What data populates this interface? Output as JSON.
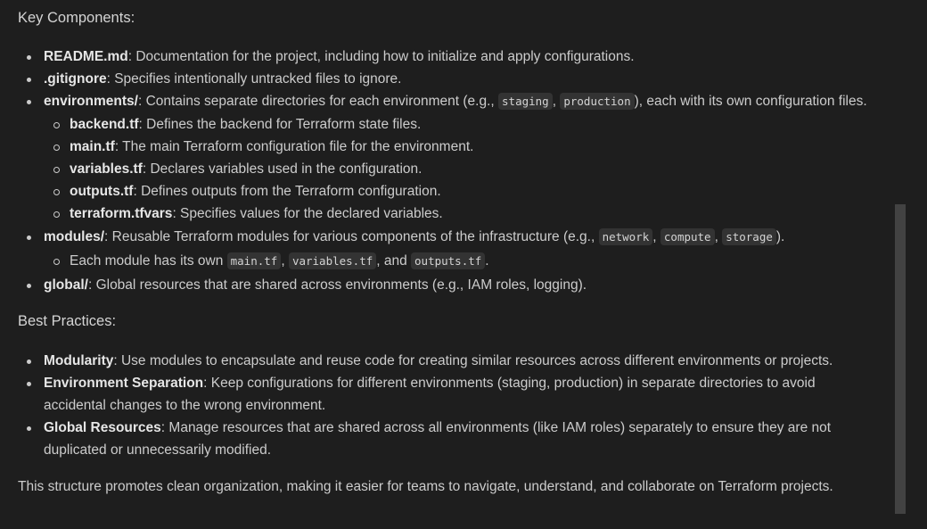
{
  "key_components": {
    "heading": "Key Components:",
    "readme": {
      "name": "README.md",
      "desc": ": Documentation for the project, including how to initialize and apply configurations."
    },
    "gitignore": {
      "name": ".gitignore",
      "desc": ": Specifies intentionally untracked files to ignore."
    },
    "environments": {
      "name": "environments/",
      "desc_pre": ": Contains separate directories for each environment (e.g., ",
      "code1": "staging",
      "sep": ", ",
      "code2": "production",
      "desc_post": "), each with its own configuration files.",
      "children": [
        {
          "name": "backend.tf",
          "desc": ": Defines the backend for Terraform state files."
        },
        {
          "name": "main.tf",
          "desc": ": The main Terraform configuration file for the environment."
        },
        {
          "name": "variables.tf",
          "desc": ": Declares variables used in the configuration."
        },
        {
          "name": "outputs.tf",
          "desc": ": Defines outputs from the Terraform configuration."
        },
        {
          "name": "terraform.tfvars",
          "desc": ": Specifies values for the declared variables."
        }
      ]
    },
    "modules": {
      "name": "modules/",
      "desc_pre": ": Reusable Terraform modules for various components of the infrastructure (e.g., ",
      "code1": "network",
      "sep1": ", ",
      "code2": "compute",
      "sep2": ", ",
      "code3": "storage",
      "desc_post": ").",
      "child": {
        "pre": "Each module has its own ",
        "code1": "main.tf",
        "sep1": ", ",
        "code2": "variables.tf",
        "sep2": ", and ",
        "code3": "outputs.tf",
        "post": "."
      }
    },
    "global": {
      "name": "global/",
      "desc": ": Global resources that are shared across environments (e.g., IAM roles, logging)."
    }
  },
  "best_practices": {
    "heading": "Best Practices:",
    "items": [
      {
        "name": "Modularity",
        "line1": ": Use modules to encapsulate and reuse code for creating similar resources across different environments or projects.",
        "line2": ""
      },
      {
        "name": "Environment Separation",
        "line1": ": Keep configurations for different environments (staging, production) in separate directories to avoid",
        "line2": "accidental changes to the wrong environment."
      },
      {
        "name": "Global Resources",
        "line1": ": Manage resources that are shared across all environments (like IAM roles) separately to ensure they are not",
        "line2": "duplicated or unnecessarily modified."
      }
    ]
  },
  "summary": "This structure promotes clean organization, making it easier for teams to navigate, understand, and collaborate on Terraform projects."
}
